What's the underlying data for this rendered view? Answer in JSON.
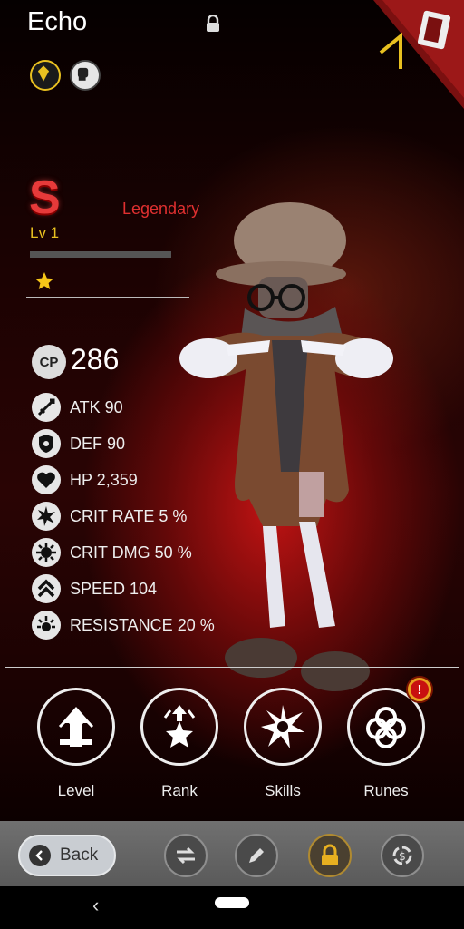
{
  "hero": {
    "name": "Echo",
    "rank_letter": "S",
    "rarity": "Legendary",
    "level": "Lv 1",
    "xp_progress": 0,
    "stars": 1,
    "cp_label": "CP",
    "cp_value": "286"
  },
  "stats": [
    {
      "icon": "sword-icon",
      "text": "ATK 90"
    },
    {
      "icon": "shield-icon",
      "text": "DEF 90"
    },
    {
      "icon": "heart-icon",
      "text": "HP 2,359"
    },
    {
      "icon": "crit-rate-icon",
      "text": "CRIT RATE 5 %"
    },
    {
      "icon": "crit-dmg-icon",
      "text": "CRIT DMG 50 %"
    },
    {
      "icon": "speed-icon",
      "text": "SPEED 104"
    },
    {
      "icon": "resistance-icon",
      "text": "RESISTANCE 20 %"
    }
  ],
  "actions": [
    {
      "id": "level",
      "label": "Level",
      "icon": "level-up-icon"
    },
    {
      "id": "rank",
      "label": "Rank",
      "icon": "rank-up-icon"
    },
    {
      "id": "skills",
      "label": "Skills",
      "icon": "skills-icon"
    },
    {
      "id": "runes",
      "label": "Runes",
      "icon": "runes-icon"
    }
  ],
  "runes_alert": "!",
  "toolbar": {
    "back_label": "Back",
    "icons": [
      "swap-icon",
      "edit-icon",
      "lock-icon",
      "sell-icon"
    ]
  },
  "colors": {
    "rank": "#e63a3a",
    "rarity": "#e03030",
    "level": "#e8c020",
    "alert": "#e8a020"
  }
}
